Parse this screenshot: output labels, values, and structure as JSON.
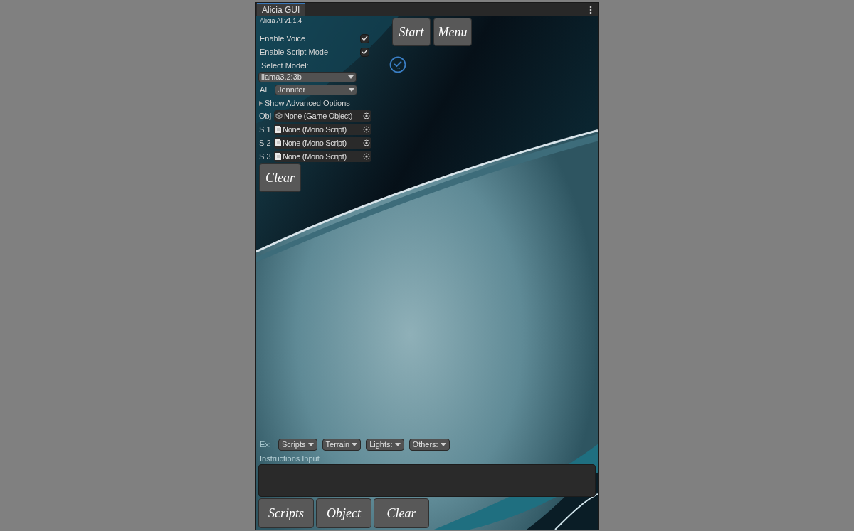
{
  "window": {
    "tab": "Alicia GUI"
  },
  "version": "Alicia AI v1.1.4",
  "toggles": [
    {
      "label": "Enable Voice",
      "checked": true
    },
    {
      "label": "Enable Script Mode",
      "checked": true
    }
  ],
  "model": {
    "label": "Select Model:",
    "value": "llama3.2:3b"
  },
  "ai": {
    "label": "AI",
    "value": "Jennifer"
  },
  "advanced": {
    "label": "Show Advanced Options",
    "expanded": false
  },
  "object_fields": [
    {
      "label": "Obj",
      "kind": "game_object",
      "value": "None (Game Object)"
    },
    {
      "label": "S 1",
      "kind": "script",
      "value": "None (Mono Script)"
    },
    {
      "label": "S 2",
      "kind": "script",
      "value": "None (Mono Script)"
    },
    {
      "label": "S 3",
      "kind": "script",
      "value": "None (Mono Script)"
    }
  ],
  "clear_top": "Clear",
  "top_buttons": [
    "Start",
    "Menu"
  ],
  "examples": {
    "label": "Ex:",
    "dropdowns": [
      "Scripts",
      "Terrain",
      "Lights:",
      "Others:"
    ]
  },
  "instructions": {
    "label": "Instructions Input"
  },
  "bottom_buttons": [
    "Scripts",
    "Object",
    "Clear"
  ]
}
